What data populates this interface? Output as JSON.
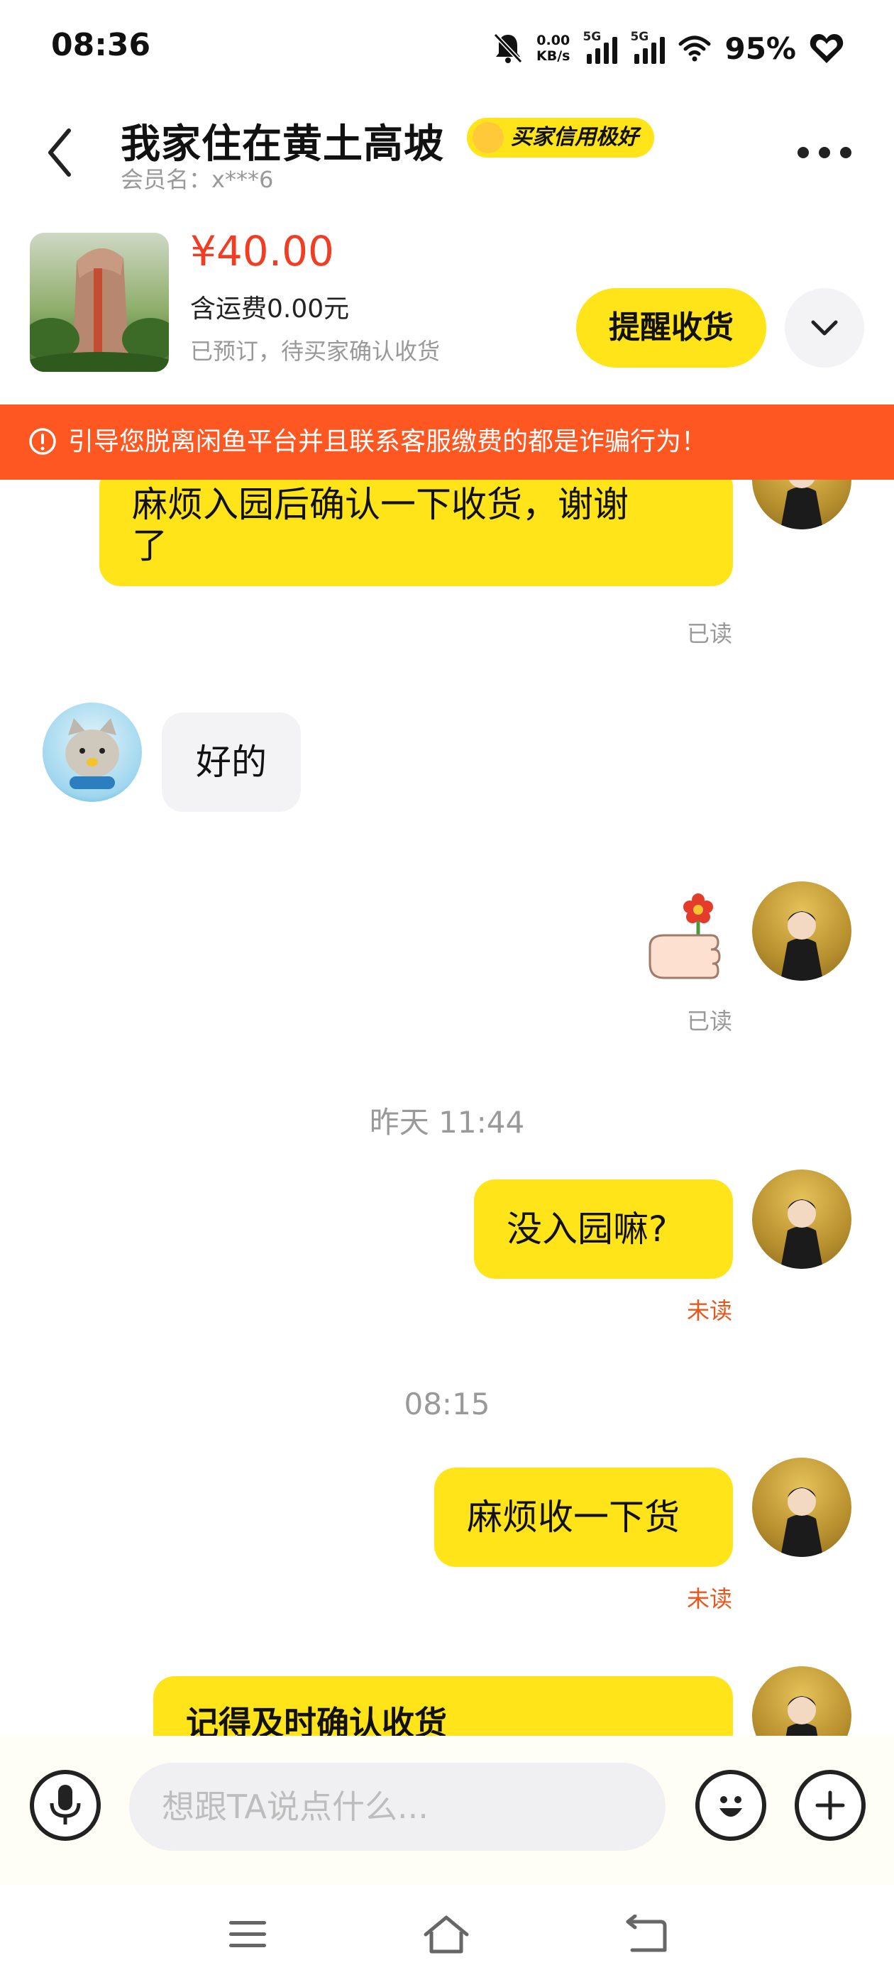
{
  "status_bar": {
    "time": "08:36",
    "net_speed_value": "0.00",
    "net_speed_unit": "KB/s",
    "signal1_label": "5G",
    "signal2_label": "5G",
    "battery": "95%",
    "icons": [
      "bell-muted-icon",
      "signal-icon",
      "signal-icon",
      "wifi-icon",
      "heart-icon"
    ]
  },
  "header": {
    "title": "我家住在黄土高坡",
    "badge": "买家信用极好",
    "member": "会员名：x***6"
  },
  "product": {
    "price": "¥40.00",
    "shipping": "含运费0.00元",
    "status": "已预订，待买家确认收货",
    "remind_button": "提醒收货"
  },
  "warning": "引导您脱离闲鱼平台并且联系客服缴费的都是诈骗行为！",
  "messages": [
    {
      "from": "me",
      "text_line1": "麻烦入园后确认一下收货，谢谢",
      "text_line2": "了",
      "status": "已读"
    },
    {
      "from": "other",
      "text": "好的"
    },
    {
      "from": "me",
      "sticker": "hand-flower-sticker",
      "status": "已读"
    },
    {
      "timestamp": "昨天 11:44"
    },
    {
      "from": "me",
      "text": "没入园嘛?",
      "status": "未读"
    },
    {
      "timestamp": "08:15"
    },
    {
      "from": "me",
      "text": "麻烦收一下货",
      "status": "未读"
    },
    {
      "from": "me",
      "card_title": "记得及时确认收货"
    }
  ],
  "input": {
    "placeholder": "想跟TA说点什么..."
  },
  "colors": {
    "accent_yellow": "#FFE41A",
    "warning_orange": "#FF5722",
    "price_red": "#F03D24",
    "unread_orange": "#E8581C"
  }
}
